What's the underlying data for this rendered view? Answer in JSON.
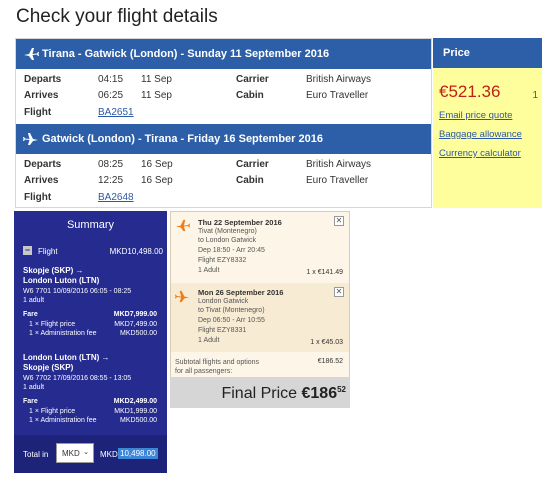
{
  "page_title": "Check your flight details",
  "outbound": {
    "header": "Tirana - Gatwick (London) - Sunday 11 September 2016",
    "departs_label": "Departs",
    "departs_time": "04:15",
    "departs_date": "11 Sep",
    "arrives_label": "Arrives",
    "arrives_time": "06:25",
    "arrives_date": "11 Sep",
    "flight_label": "Flight",
    "flight_no": "BA2651",
    "carrier_label": "Carrier",
    "carrier": "British Airways",
    "cabin_label": "Cabin",
    "cabin": "Euro Traveller"
  },
  "inbound": {
    "header": "Gatwick (London) - Tirana - Friday 16 September 2016",
    "departs_label": "Departs",
    "departs_time": "08:25",
    "departs_date": "16 Sep",
    "arrives_label": "Arrives",
    "arrives_time": "12:25",
    "arrives_date": "16 Sep",
    "flight_label": "Flight",
    "flight_no": "BA2648",
    "carrier_label": "Carrier",
    "carrier": "British Airways",
    "cabin_label": "Cabin",
    "cabin": "Euro Traveller"
  },
  "price": {
    "header": "Price",
    "amount": "€521.36",
    "partial": "1",
    "links": [
      "Email price quote",
      "Baggage allowance",
      "Currency calculator"
    ]
  },
  "summary": {
    "title": "Summary",
    "flight_label": "Flight",
    "flight_total": "MKD10,498.00",
    "leg1": {
      "route_from": "Skopje (SKP) →",
      "route_to": "London Luton (LTN)",
      "details": "W6 7701  10/09/2016 06:05 - 08:25",
      "pax": "1 adult",
      "fare_label": "Fare",
      "fare_value": "MKD7,999.00",
      "line1_label": "1 × Flight price",
      "line1_value": "MKD7,499.00",
      "line2_label": "1 × Administration fee",
      "line2_value": "MKD500.00"
    },
    "leg2": {
      "route_from": "London Luton (LTN) →",
      "route_to": "Skopje (SKP)",
      "details": "W6 7702  17/09/2016 08:55 - 13:05",
      "pax": "1 adult",
      "fare_label": "Fare",
      "fare_value": "MKD2,499.00",
      "line1_label": "1 × Flight price",
      "line1_value": "MKD1,999.00",
      "line2_label": "1 × Administration fee",
      "line2_value": "MKD500.00"
    },
    "total_label": "Total in",
    "currency": "MKD",
    "total_code": "MKD",
    "total_value": "10,498.00"
  },
  "tivat": {
    "flight1": {
      "date": "Thu 22 September 2016",
      "from": "Tivat (Montenegro)",
      "to": "to London Gatwick",
      "times": "Dep 18:50 - Arr 20:45",
      "flight": "Flight EZY8332",
      "pax": "1 Adult",
      "price": "1 x €141.49"
    },
    "flight2": {
      "date": "Mon 26 September 2016",
      "from": "London Gatwick",
      "to": "to Tivat (Montenegro)",
      "times": "Dep 06:50 - Arr 10:55",
      "flight": "Flight EZY8331",
      "pax": "1 Adult",
      "price": "1 x €45.03"
    },
    "subtotal_line1": "Subtotal flights and options",
    "subtotal_line2": "for all passengers:",
    "subtotal_value": "€186.52",
    "final_label": "Final Price",
    "final_value": "€186",
    "final_cents": "52"
  }
}
